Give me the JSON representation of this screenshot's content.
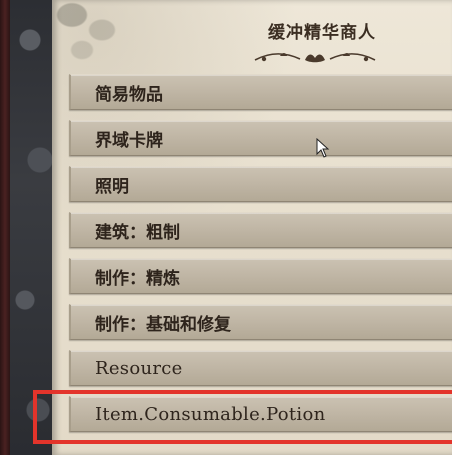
{
  "merchant": {
    "title": "缓冲精华商人"
  },
  "categories": [
    {
      "label": "简易物品"
    },
    {
      "label": "界域卡牌"
    },
    {
      "label": "照明"
    },
    {
      "label": "建筑：粗制"
    },
    {
      "label": "制作：精炼"
    },
    {
      "label": "制作：基础和修复"
    },
    {
      "label": "Resource"
    },
    {
      "label": "Item.Consumable.Potion"
    }
  ],
  "highlight": {
    "color": "#e3342b",
    "target": "Item.Consumable.Potion"
  },
  "icons": {
    "ornament": "floral-divider-icon",
    "cursor": "mouse-pointer-icon"
  }
}
